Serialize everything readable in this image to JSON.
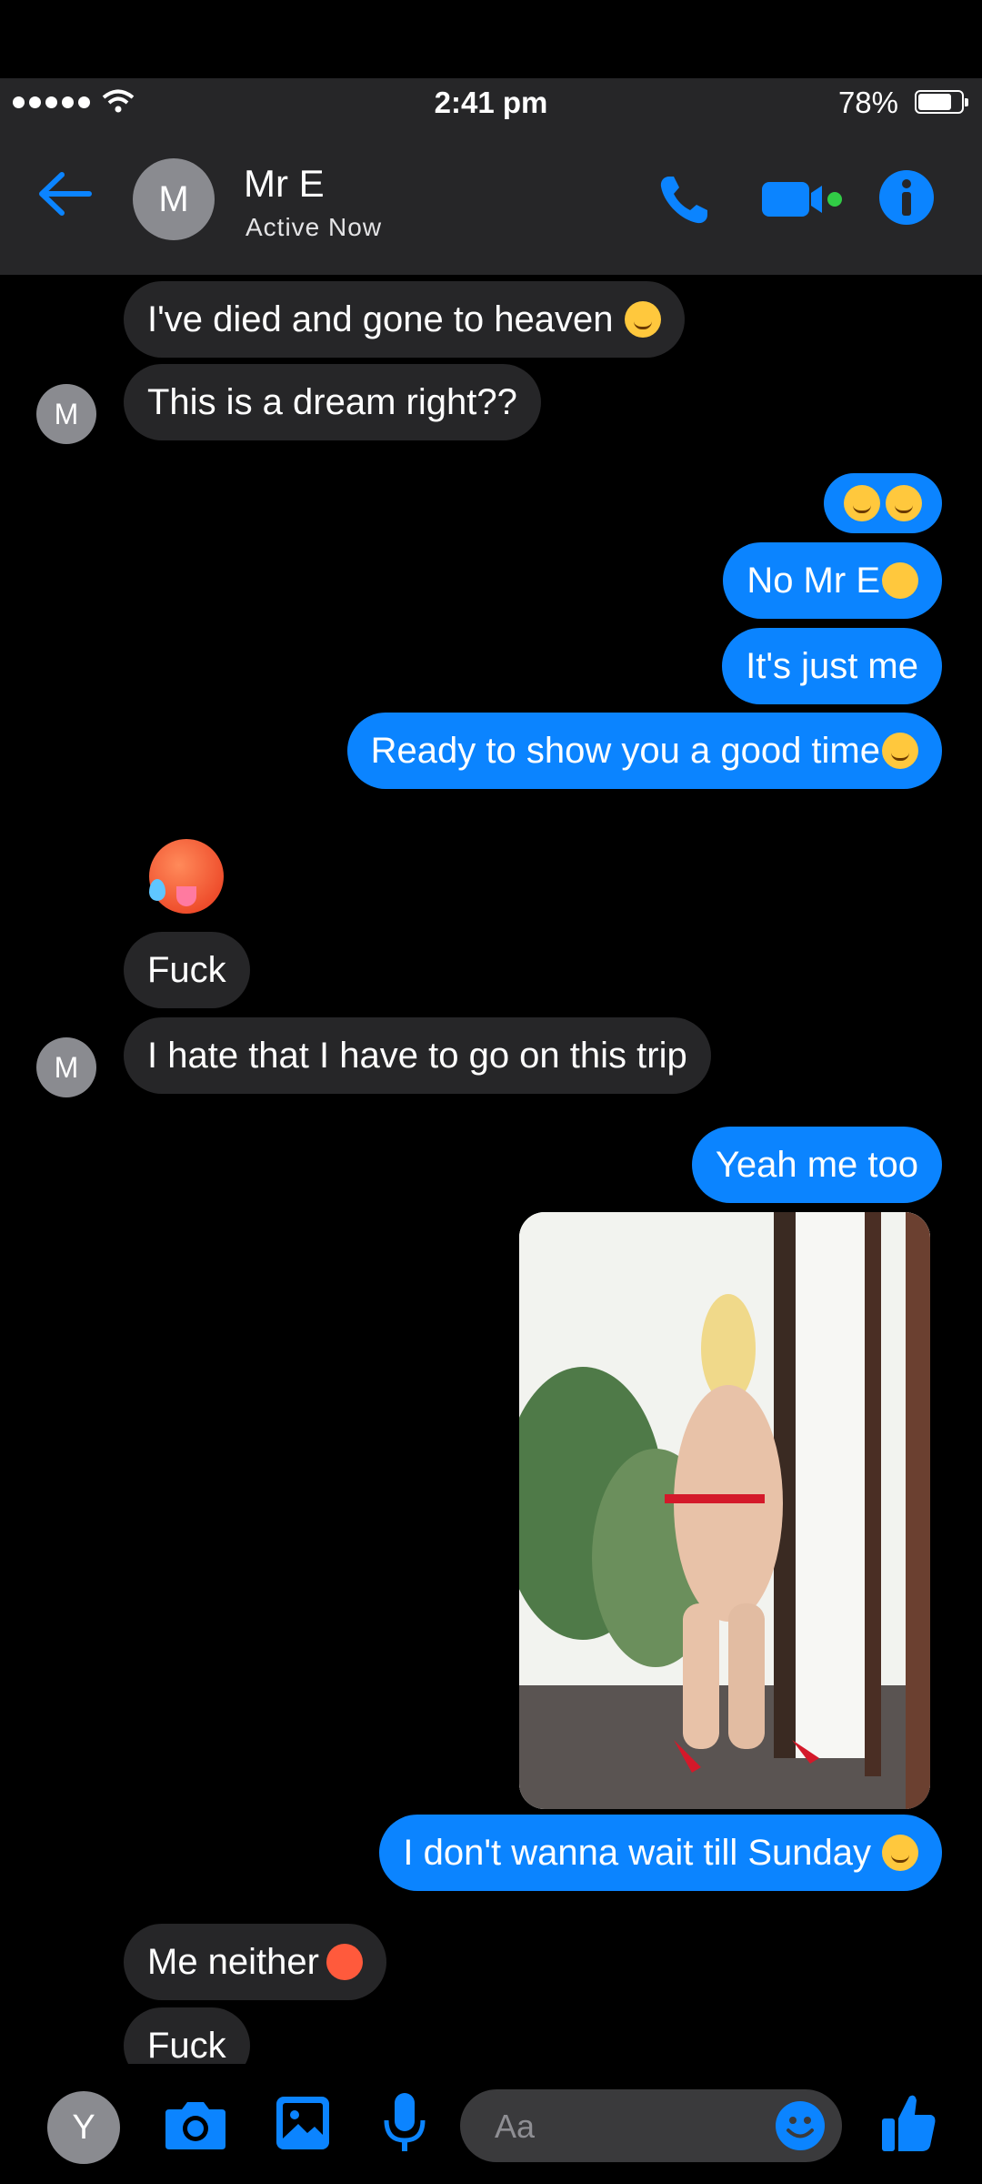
{
  "status": {
    "time": "2:41 pm",
    "battery": "78%",
    "battery_level": 0.78
  },
  "header": {
    "contact_name": "Mr E",
    "contact_initial": "M",
    "contact_status": "Active Now"
  },
  "messages": [
    {
      "dir": "in",
      "text": "I've died and gone to heaven",
      "emoji": "drooling-face"
    },
    {
      "dir": "in",
      "text": "This is a dream right??"
    },
    {
      "dir": "out",
      "text": "",
      "emoji": "rofl-rofl"
    },
    {
      "dir": "out",
      "text": "No Mr E",
      "emoji": "kissing-face"
    },
    {
      "dir": "out",
      "text": "It's just me"
    },
    {
      "dir": "out",
      "text": "Ready to show you a good time",
      "emoji": "relieved-face"
    },
    {
      "dir": "in",
      "text": "",
      "emoji": "hot-face"
    },
    {
      "dir": "in",
      "text": "Fuck"
    },
    {
      "dir": "in",
      "text": "I hate that I have to go on this trip"
    },
    {
      "dir": "out",
      "text": "Yeah me too"
    },
    {
      "dir": "out",
      "type": "photo"
    },
    {
      "dir": "out",
      "text": "I don't wanna wait till Sunday",
      "emoji": "relieved-face"
    },
    {
      "dir": "in",
      "text": "Me neither",
      "emoji": "hot-face"
    },
    {
      "dir": "in",
      "text": "Fuck"
    }
  ],
  "composer": {
    "user_initial": "Y",
    "placeholder": "Aa"
  },
  "colors": {
    "accent": "#0b84ff",
    "bubble_in": "#262628",
    "bar": "#262628"
  }
}
